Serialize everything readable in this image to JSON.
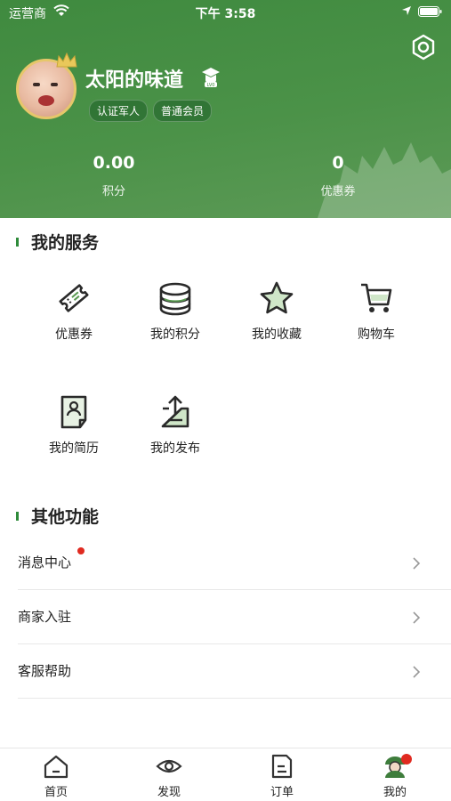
{
  "status_bar": {
    "carrier": "运营商",
    "time": "下午 3:58"
  },
  "profile": {
    "username": "太阳的味道",
    "badges": [
      "认证军人",
      "普通会员"
    ]
  },
  "stats": {
    "points_value": "0.00",
    "points_label": "积分",
    "coupons_value": "0",
    "coupons_label": "优惠券"
  },
  "my_services": {
    "title": "我的服务",
    "items": [
      {
        "label": "优惠券",
        "icon": "ticket-icon"
      },
      {
        "label": "我的积分",
        "icon": "coins-icon"
      },
      {
        "label": "我的收藏",
        "icon": "star-icon"
      },
      {
        "label": "购物车",
        "icon": "cart-icon"
      },
      {
        "label": "我的简历",
        "icon": "resume-icon"
      },
      {
        "label": "我的发布",
        "icon": "upload-icon"
      }
    ]
  },
  "other_functions": {
    "title": "其他功能",
    "rows": [
      {
        "label": "消息中心",
        "has_dot": true
      },
      {
        "label": "商家入驻",
        "has_dot": false
      },
      {
        "label": "客服帮助",
        "has_dot": false
      }
    ]
  },
  "tabbar": {
    "tabs": [
      {
        "label": "首页",
        "icon": "home-icon"
      },
      {
        "label": "发现",
        "icon": "eye-icon"
      },
      {
        "label": "订单",
        "icon": "order-icon"
      },
      {
        "label": "我的",
        "icon": "soldier-avatar-icon"
      }
    ]
  },
  "colors": {
    "header_green": "#4b9248",
    "accent_green": "#2e8b3a",
    "notify_red": "#e02a20"
  }
}
